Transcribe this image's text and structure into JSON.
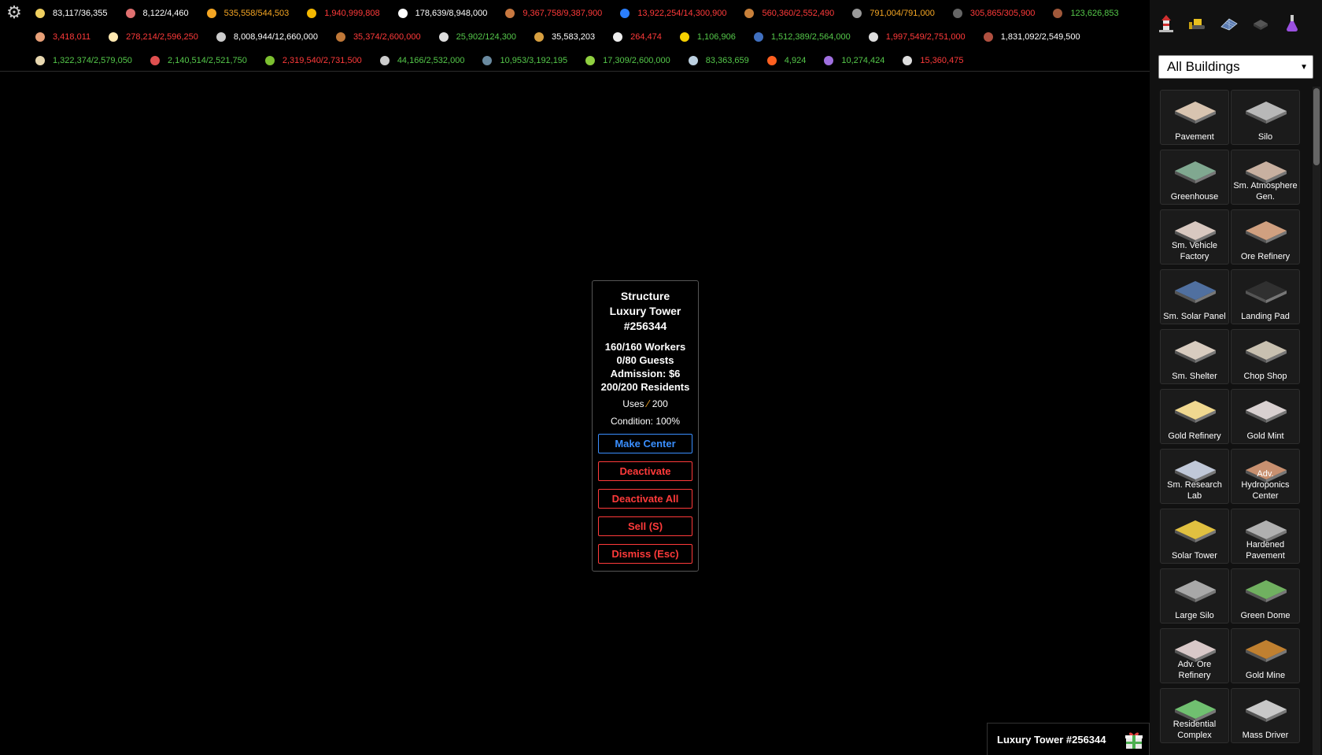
{
  "settings": {
    "icon": "gear-icon"
  },
  "resources": {
    "row1": [
      {
        "icon": "lightbulb-icon",
        "color": "#f0d060",
        "text": "83,117/36,355",
        "cls": "c-white"
      },
      {
        "icon": "person-icon",
        "color": "#e07070",
        "text": "8,122/4,460",
        "cls": "c-white"
      },
      {
        "icon": "fuel-icon",
        "color": "#f5a623",
        "text": "535,558/544,503",
        "cls": "c-orange"
      },
      {
        "icon": "coin-icon",
        "color": "#f5b800",
        "text": "1,940,999,808",
        "cls": "c-red"
      },
      {
        "icon": "regolith-icon",
        "color": "#ffffff",
        "text": "178,639/8,948,000",
        "cls": "c-white"
      },
      {
        "icon": "bread-icon",
        "color": "#c87840",
        "text": "9,367,758/9,387,900",
        "cls": "c-red"
      },
      {
        "icon": "water-icon",
        "color": "#2b7fff",
        "text": "13,922,254/14,300,900",
        "cls": "c-red"
      },
      {
        "icon": "bottle-icon",
        "color": "#c8803a",
        "text": "560,360/2,552,490",
        "cls": "c-red"
      },
      {
        "icon": "iron-icon",
        "color": "#999999",
        "text": "791,004/791,000",
        "cls": "c-orange"
      },
      {
        "icon": "rock-icon",
        "color": "#666666",
        "text": "305,865/305,900",
        "cls": "c-red"
      },
      {
        "icon": "meat-icon",
        "color": "#a0583a",
        "text": "123,626,853",
        "cls": "c-green"
      }
    ],
    "row2": [
      {
        "icon": "cookie-icon",
        "color": "#e8a078",
        "text": "3,418,011",
        "cls": "c-red"
      },
      {
        "icon": "cloth-icon",
        "color": "#ffe8b0",
        "text": "278,214/2,596,250",
        "cls": "c-red"
      },
      {
        "icon": "pipe-icon",
        "color": "#cccccc",
        "text": "8,008,944/12,660,000",
        "cls": "c-white"
      },
      {
        "icon": "wood-icon",
        "color": "#c07838",
        "text": "35,374/2,600,000",
        "cls": "c-red"
      },
      {
        "icon": "battery-icon",
        "color": "#dddddd",
        "text": "25,902/124,300",
        "cls": "c-green"
      },
      {
        "icon": "nugget-icon",
        "color": "#d8a040",
        "text": "35,583,203",
        "cls": "c-white"
      },
      {
        "icon": "chalk-icon",
        "color": "#eeeeee",
        "text": "264,474",
        "cls": "c-red"
      },
      {
        "icon": "radiation-icon",
        "color": "#f5d000",
        "text": "1,106,906",
        "cls": "c-green"
      },
      {
        "icon": "book-icon",
        "color": "#4070c0",
        "text": "1,512,389/2,564,000",
        "cls": "c-green"
      },
      {
        "icon": "cloud-icon",
        "color": "#dddddd",
        "text": "1,997,549/2,751,000",
        "cls": "c-red"
      },
      {
        "icon": "steak-icon",
        "color": "#b05040",
        "text": "1,831,092/2,549,500",
        "cls": "c-white"
      }
    ],
    "row3": [
      {
        "icon": "bandage-icon",
        "color": "#e8d8b0",
        "text": "1,322,374/2,579,050",
        "cls": "c-green"
      },
      {
        "icon": "rainbow-icon",
        "color": "#e05050",
        "text": "2,140,514/2,521,750",
        "cls": "c-green"
      },
      {
        "icon": "circuit-icon",
        "color": "#7cc030",
        "text": "2,319,540/2,731,500",
        "cls": "c-red"
      },
      {
        "icon": "robot-icon",
        "color": "#cccccc",
        "text": "44,166/2,532,000",
        "cls": "c-green"
      },
      {
        "icon": "gem-icon",
        "color": "#6a8aa0",
        "text": "10,953/3,192,195",
        "cls": "c-green"
      },
      {
        "icon": "leaf-icon",
        "color": "#90d040",
        "text": "17,309/2,600,000",
        "cls": "c-green"
      },
      {
        "icon": "cloud-icon",
        "color": "#bcd0e0",
        "text": "83,363,659",
        "cls": "c-green"
      },
      {
        "icon": "fire-icon",
        "color": "#ff6020",
        "text": "4,924",
        "cls": "c-green"
      },
      {
        "icon": "potion-icon",
        "color": "#a070e0",
        "text": "10,274,424",
        "cls": "c-green"
      },
      {
        "icon": "bank-icon",
        "color": "#dddddd",
        "text": "15,360,475",
        "cls": "c-red"
      }
    ]
  },
  "popup": {
    "title1": "Structure",
    "title2": "Luxury Tower",
    "title3": "#256344",
    "workers": "160/160 Workers",
    "guests": "0/80 Guests",
    "admission": "Admission: $6",
    "residents": "200/200 Residents",
    "uses_label": "Uses",
    "uses_value": "200",
    "condition": "Condition: 100%",
    "buttons": {
      "make_center": "Make Center",
      "deactivate": "Deactivate",
      "deactivate_all": "Deactivate All",
      "sell": "Sell (S)",
      "dismiss": "Dismiss (Esc)"
    }
  },
  "sidebar": {
    "filter": "All Buildings",
    "categories": [
      "lighthouse-icon",
      "bulldozer-icon",
      "solar-panel-icon",
      "ore-icon",
      "flask-icon"
    ],
    "buildings": [
      {
        "label": "Pavement",
        "color": "#d8c4b0"
      },
      {
        "label": "Silo",
        "color": "#b8b8b8"
      },
      {
        "label": "Greenhouse",
        "color": "#80a890"
      },
      {
        "label": "Sm. Atmosphere Gen.",
        "color": "#c8b0a0"
      },
      {
        "label": "Sm. Vehicle Factory",
        "color": "#d8c8c0"
      },
      {
        "label": "Ore Refinery",
        "color": "#d0a080"
      },
      {
        "label": "Sm. Solar Panel",
        "color": "#5070a0"
      },
      {
        "label": "Landing Pad",
        "color": "#303030"
      },
      {
        "label": "Sm. Shelter",
        "color": "#d8ccc0"
      },
      {
        "label": "Chop Shop",
        "color": "#c8c0b0"
      },
      {
        "label": "Gold Refinery",
        "color": "#f0d890"
      },
      {
        "label": "Gold Mint",
        "color": "#d8d0d0"
      },
      {
        "label": "Sm. Research Lab",
        "color": "#c0c8d8"
      },
      {
        "label": "Adv. Hydroponics Center",
        "color": "#c89070"
      },
      {
        "label": "Solar Tower",
        "color": "#e0c040"
      },
      {
        "label": "Hardened Pavement",
        "color": "#b0b0b0"
      },
      {
        "label": "Large Silo",
        "color": "#a8a8a8"
      },
      {
        "label": "Green Dome",
        "color": "#70b060"
      },
      {
        "label": "Adv. Ore Refinery",
        "color": "#d8c8c8"
      },
      {
        "label": "Gold Mine",
        "color": "#c08030"
      },
      {
        "label": "Residential Complex",
        "color": "#70c070"
      },
      {
        "label": "Mass Driver",
        "color": "#c8c8c8"
      }
    ]
  },
  "toast": {
    "label": "Luxury Tower #256344"
  }
}
